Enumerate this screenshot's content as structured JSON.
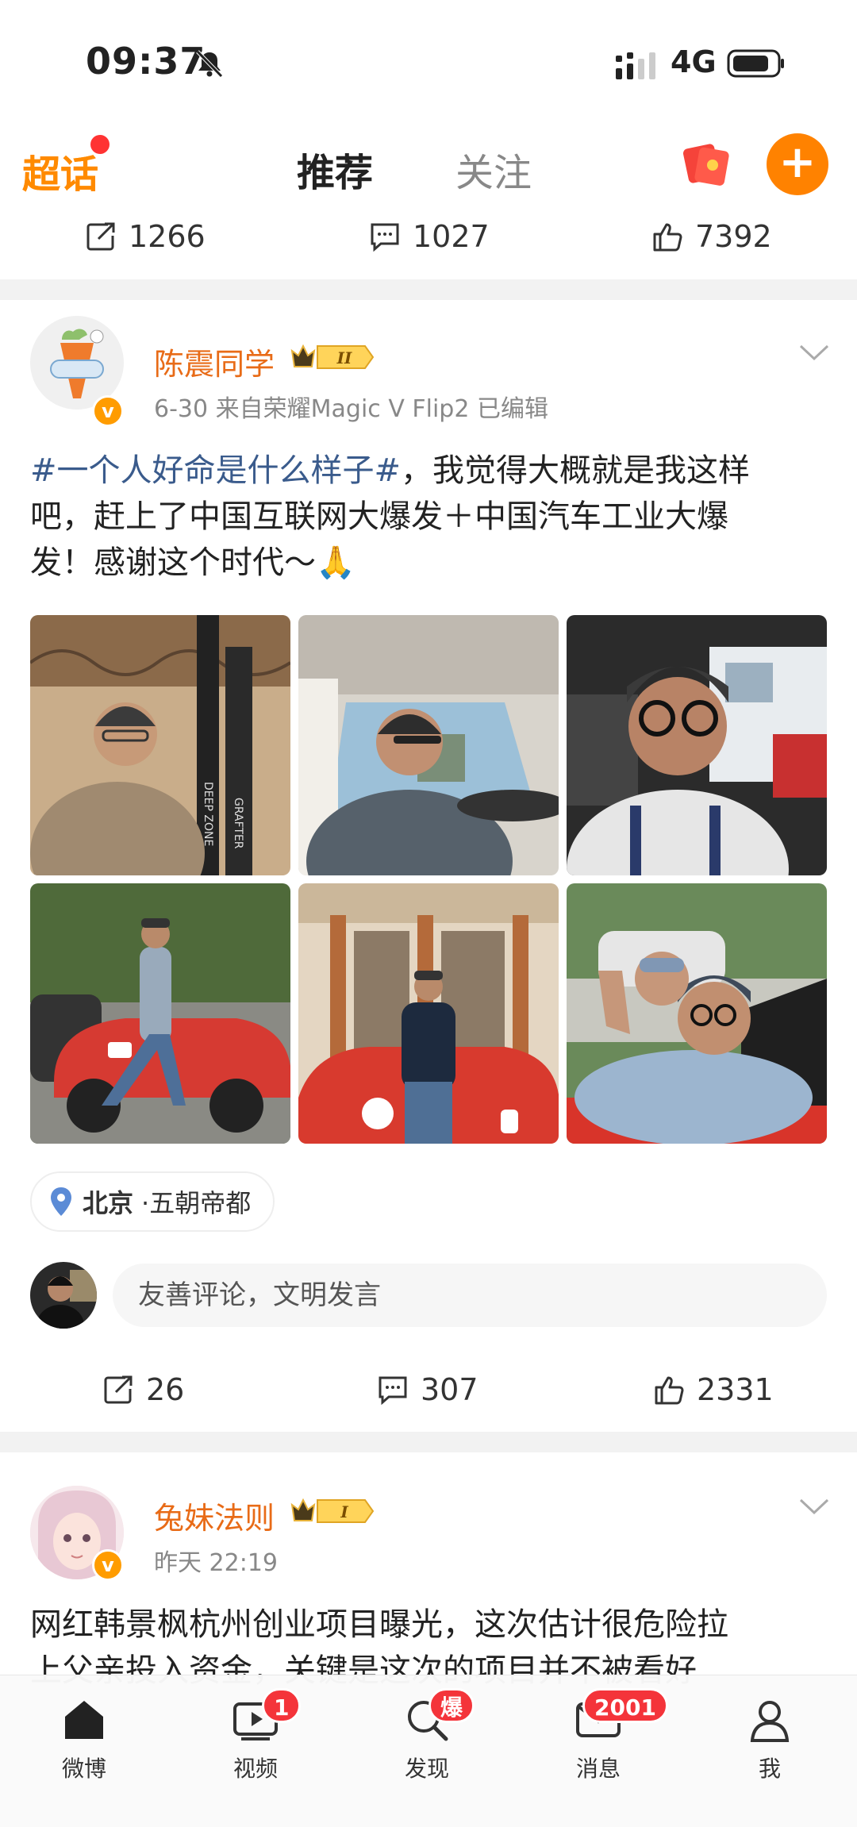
{
  "status_bar": {
    "time": "09:37",
    "network": "4G"
  },
  "top_nav": {
    "super_topic_label": "超话",
    "tabs": [
      {
        "label": "推荐",
        "active": true
      },
      {
        "label": "关注",
        "active": false
      }
    ]
  },
  "prev_post_actions": {
    "reposts": "1266",
    "comments": "1027",
    "likes": "7392"
  },
  "post1": {
    "username": "陈震同学",
    "level_badge": "II",
    "date": "6-30",
    "source": "来自荣耀Magic V Flip2",
    "edited": "已编辑",
    "topic": "#一个人好命是什么样子#",
    "text_line1_rest": "，我觉得大概就是我这样",
    "text_line2": "吧，赶上了中国互联网大爆发＋中国汽车工业大爆",
    "text_line3": "发！感谢这个时代～🙏",
    "location_city": "北京",
    "location_detail": "·五朝帝都",
    "comment_placeholder": "友善评论，文明发言",
    "reposts": "26",
    "comments": "307",
    "likes": "2331",
    "photo_text_1": "DEEP ZONE",
    "photo_text_2": "GRAFTER"
  },
  "post2": {
    "username": "兔妹法则",
    "level_badge": "I",
    "time": "昨天 22:19",
    "text_line1": "网红韩景枫杭州创业项目曝光，这次估计很危险拉",
    "text_line2": "上父亲投入资金，关键是这次的项目并不被看好"
  },
  "tab_bar": {
    "items": [
      {
        "label": "微博",
        "icon": "home-icon"
      },
      {
        "label": "视频",
        "icon": "video-icon",
        "badge": "1"
      },
      {
        "label": "发现",
        "icon": "discover-icon",
        "badge": "爆"
      },
      {
        "label": "消息",
        "icon": "message-icon",
        "badge": "2001"
      },
      {
        "label": "我",
        "icon": "profile-icon"
      }
    ]
  },
  "colors": {
    "accent": "#ff8200",
    "username": "#e86b17",
    "topic": "#3a5b8c",
    "badge": "#f4343a"
  }
}
